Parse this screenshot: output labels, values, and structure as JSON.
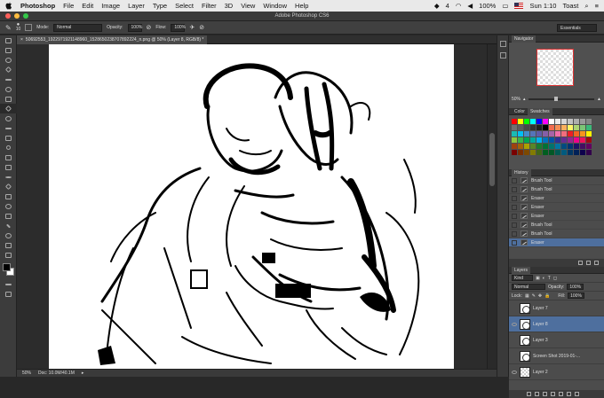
{
  "menubar": {
    "app_name": "Photoshop",
    "items": [
      "File",
      "Edit",
      "Image",
      "Layer",
      "Type",
      "Select",
      "Filter",
      "3D",
      "View",
      "Window",
      "Help"
    ],
    "status": {
      "badge_count": "4",
      "battery": "100%",
      "clock": "Sun 1:10",
      "user": "Toast"
    }
  },
  "window": {
    "title": "Adobe Photoshop CS6"
  },
  "options_bar": {
    "brush_size": "10",
    "mode_label": "Mode:",
    "mode_value": "Normal",
    "opacity_label": "Opacity:",
    "opacity_value": "100%",
    "flow_label": "Flow:",
    "flow_value": "100%",
    "workspace": "Essentials"
  },
  "document": {
    "tab_title": "50692553_1922971921148960_1528650238707892224_n.png @ 50% (Layer 8, RGB/8) *",
    "zoom": "50%",
    "doc_size": "Doc: 10.0M/40.1M"
  },
  "navigator": {
    "title": "Navigator",
    "zoom": "50%"
  },
  "color_panel": {
    "tabs": [
      "Color",
      "Swatches"
    ]
  },
  "swatches": {
    "rows": [
      [
        "#ff0000",
        "#ffff00",
        "#00ff00",
        "#00ffff",
        "#0000ff",
        "#ff00ff",
        "#ffffff",
        "#ebebeb",
        "#d6d6d6",
        "#c2c2c2",
        "#adadad",
        "#999999",
        "#858585"
      ],
      [
        "#707070",
        "#5c5c5c",
        "#474747",
        "#333333",
        "#1f1f1f",
        "#000000",
        "#f26c4f",
        "#f68e55",
        "#fbaf5c",
        "#fff467",
        "#acd372",
        "#7cc576",
        "#3bb878"
      ],
      [
        "#1abbb4",
        "#00bff3",
        "#438ccb",
        "#5574b9",
        "#605ca8",
        "#855fa8",
        "#a763a8",
        "#f06ea9",
        "#f26d7d",
        "#ed1c24",
        "#f26522",
        "#f7941d",
        "#fff200"
      ],
      [
        "#8dc73f",
        "#39b54a",
        "#00a651",
        "#00a99d",
        "#00aeef",
        "#0072bc",
        "#0054a6",
        "#2e3192",
        "#662d91",
        "#92278f",
        "#ec008c",
        "#ed145b",
        "#9e0b0f"
      ],
      [
        "#a0410d",
        "#a36209",
        "#aba000",
        "#598527",
        "#197b30",
        "#007236",
        "#00746b",
        "#0076a3",
        "#004b80",
        "#003471",
        "#1b1464",
        "#440e62",
        "#630460"
      ],
      [
        "#790000",
        "#7b2e00",
        "#7d4900",
        "#827b00",
        "#406618",
        "#005e20",
        "#005826",
        "#005952",
        "#005b7f",
        "#003663",
        "#002157",
        "#0d004c",
        "#32004b"
      ]
    ]
  },
  "history": {
    "title": "History",
    "items": [
      "Brush Tool",
      "Brush Tool",
      "Eraser",
      "Eraser",
      "Eraser",
      "Brush Tool",
      "Brush Tool",
      "Eraser"
    ]
  },
  "layers": {
    "title": "Layers",
    "filter": "Kind",
    "blend": "Normal",
    "opacity_label": "Opacity:",
    "opacity_value": "100%",
    "lock_label": "Lock:",
    "fill_label": "Fill:",
    "fill_value": "100%",
    "items": [
      "Layer 7",
      "Layer 8",
      "Layer 3",
      "Screen Shot 2019-01-...",
      "Layer 2"
    ]
  }
}
